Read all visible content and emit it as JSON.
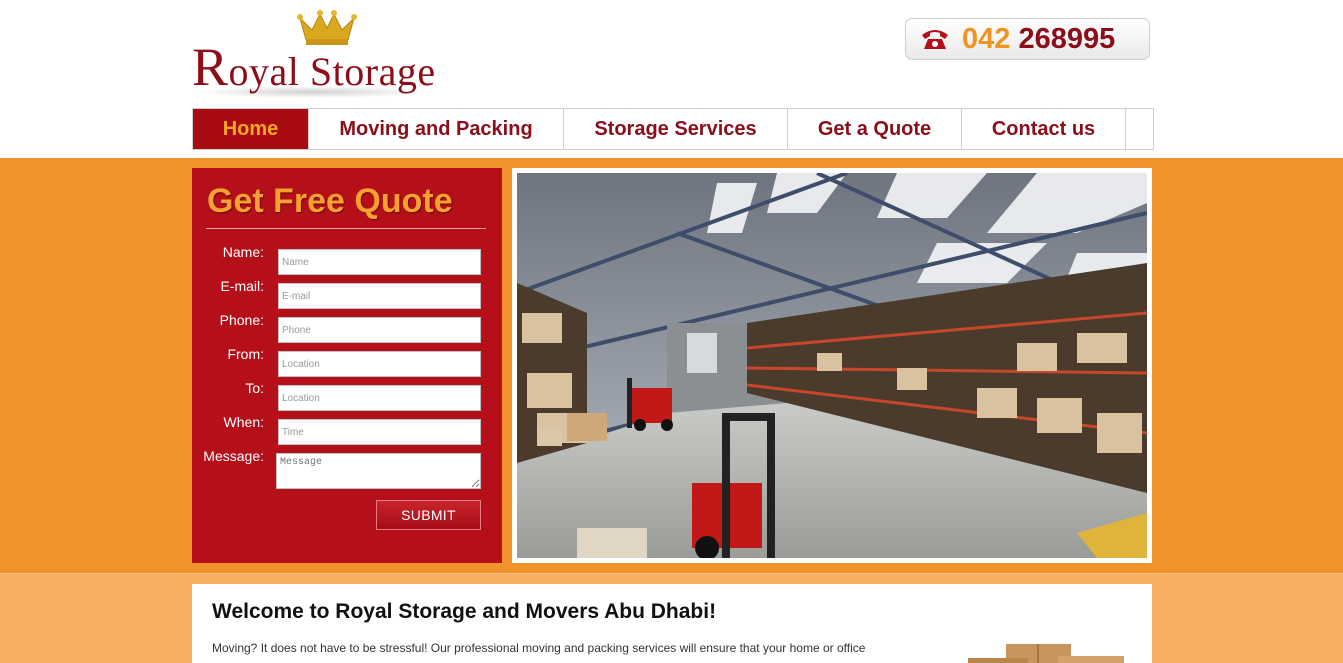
{
  "brand": {
    "name_initial": "R",
    "name_rest": "oyal Storage"
  },
  "phone": {
    "prefix": "042",
    "number": "268995"
  },
  "nav": {
    "items": [
      {
        "label": "Home",
        "active": true
      },
      {
        "label": "Moving and Packing",
        "active": false
      },
      {
        "label": "Storage Services",
        "active": false
      },
      {
        "label": "Get a Quote",
        "active": false
      },
      {
        "label": "Contact us",
        "active": false
      }
    ]
  },
  "quote": {
    "title": "Get Free Quote",
    "fields": {
      "name": {
        "label": "Name:",
        "placeholder": "Name"
      },
      "email": {
        "label": "E-mail:",
        "placeholder": "E-mail"
      },
      "phone": {
        "label": "Phone:",
        "placeholder": "Phone"
      },
      "from": {
        "label": "From:",
        "placeholder": "Location"
      },
      "to": {
        "label": "To:",
        "placeholder": "Location"
      },
      "when": {
        "label": "When:",
        "placeholder": "Time"
      },
      "message": {
        "label": "Message:",
        "placeholder": "Message"
      }
    },
    "submit_label": "SUBMIT"
  },
  "welcome": {
    "heading": "Welcome to Royal Storage and Movers Abu Dhabi!",
    "body": "Moving? It does not have to be stressful! Our professional moving and packing services will ensure that your home or office"
  },
  "colors": {
    "brand_red": "#8b0e1a",
    "accent_orange": "#f2922a",
    "form_red": "#b51019",
    "gold": "#f5a623"
  },
  "icons": {
    "phone": "telephone-icon",
    "crown": "crown-icon"
  }
}
